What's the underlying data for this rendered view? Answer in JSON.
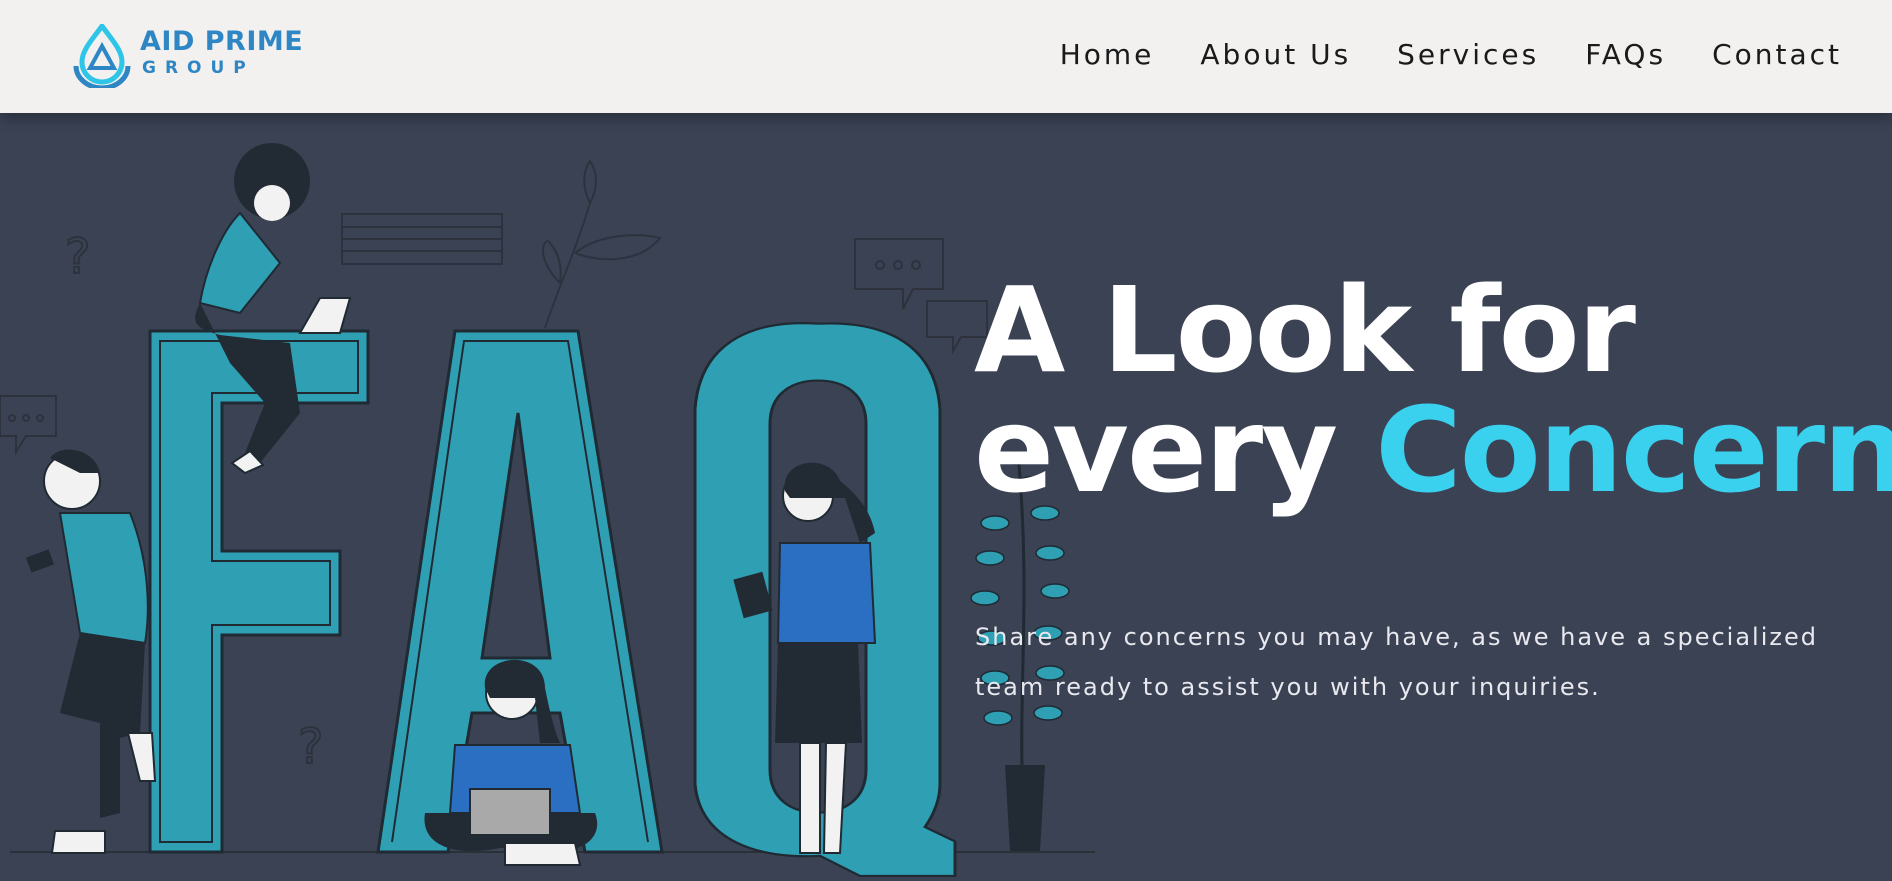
{
  "brand": {
    "name": "AID PRIME",
    "sub": "GROUP",
    "color": "#2f86c4"
  },
  "nav": [
    {
      "label": "Home"
    },
    {
      "label": "About Us"
    },
    {
      "label": "Services"
    },
    {
      "label": "FAQs"
    },
    {
      "label": "Contact"
    }
  ],
  "hero": {
    "headline_line1": "A Look for",
    "headline_line2_prefix": "every ",
    "headline_accent": "Concern",
    "headline_suffix": ".",
    "description": "Share any concerns you may have, as we have a specialized team ready to assist you with your inquiries.",
    "accent_color": "#3ad1ee",
    "background": "#3a4254"
  },
  "illustration": {
    "letters": [
      "F",
      "A",
      "Q"
    ],
    "fill_color": "#2fa0b4"
  }
}
